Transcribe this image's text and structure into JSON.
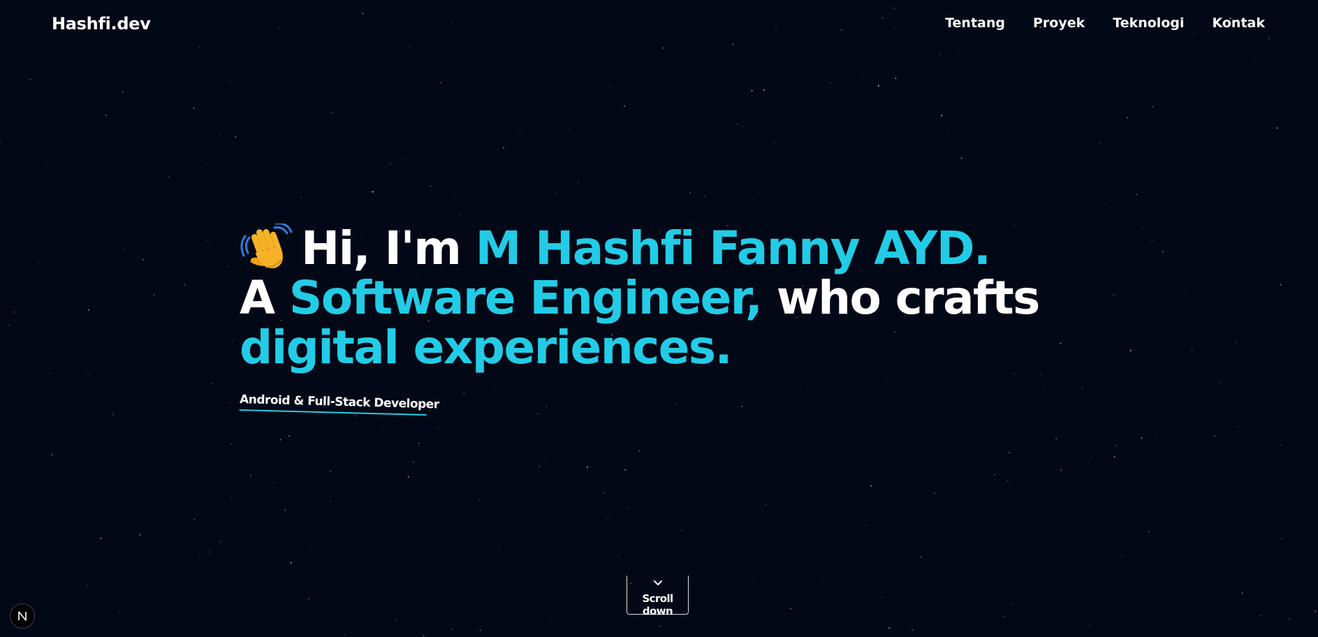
{
  "header": {
    "logo": "Hashfi.dev",
    "nav": [
      {
        "label": "Tentang"
      },
      {
        "label": "Proyek"
      },
      {
        "label": "Teknologi"
      },
      {
        "label": "Kontak"
      }
    ]
  },
  "hero": {
    "greeting_prefix": "Hi, I'm ",
    "name": "M Hashfi Fanny AYD.",
    "line2_prefix": "A ",
    "role": "Software Engineer,",
    "line2_suffix": " who crafts",
    "line3": "digital experiences.",
    "subtitle": "Android & Full-Stack Developer",
    "wave_icon": "waving-hand-icon"
  },
  "scroll": {
    "label": "Scroll down",
    "icon": "chevron-down-icon"
  },
  "badge": {
    "icon": "nextjs-logo-icon"
  },
  "colors": {
    "background": "#030816",
    "accent": "#22cce6",
    "text": "#ffffff"
  }
}
